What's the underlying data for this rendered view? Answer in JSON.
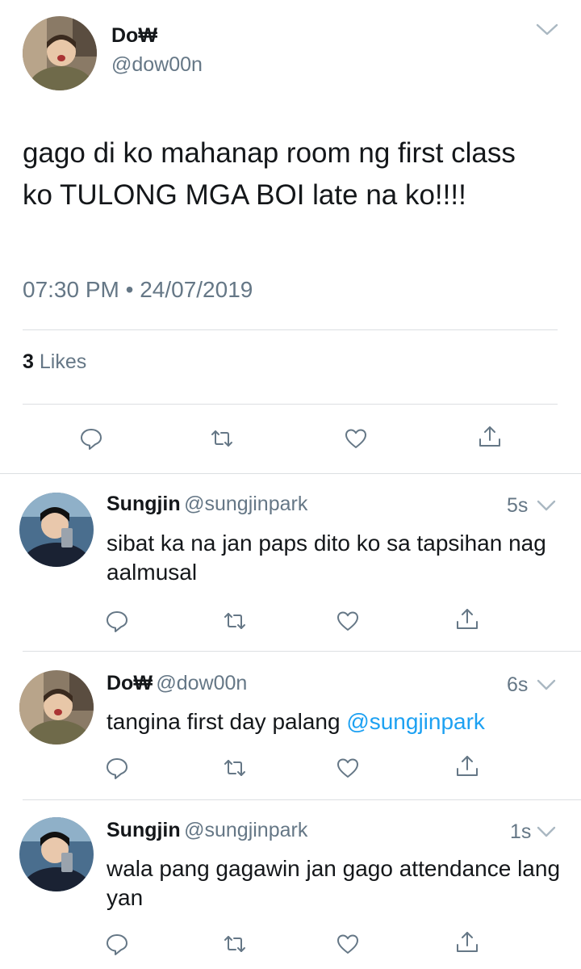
{
  "main_tweet": {
    "author_name": "Do₩",
    "author_handle": "@dow00n",
    "text": "gago di ko mahanap room ng first class ko TULONG MGA BOI late na ko!!!!",
    "timestamp": "07:30 PM • 24/07/2019",
    "likes_count": "3",
    "likes_label": "Likes"
  },
  "replies": [
    {
      "author_name": "Sungjin",
      "author_handle": "@sungjinpark",
      "time": "5s",
      "text": "sibat ka na jan paps dito ko sa tapsihan nag aalmusal"
    },
    {
      "author_name": "Do₩",
      "author_handle": "@dow00n",
      "time": "6s",
      "text": "tangina first day palang ",
      "mention": "@sungjinpark"
    },
    {
      "author_name": "Sungjin",
      "author_handle": "@sungjinpark",
      "time": "1s",
      "text": "wala pang gagawin jan gago attendance lang yan"
    }
  ],
  "icons": {
    "reply": "reply-icon",
    "retweet": "retweet-icon",
    "like": "heart-icon",
    "share": "share-icon",
    "menu": "chevron-down-icon"
  },
  "colors": {
    "text": "#14171a",
    "secondary": "#657786",
    "link": "#1da1f2",
    "divider": "#dcdfe2"
  }
}
